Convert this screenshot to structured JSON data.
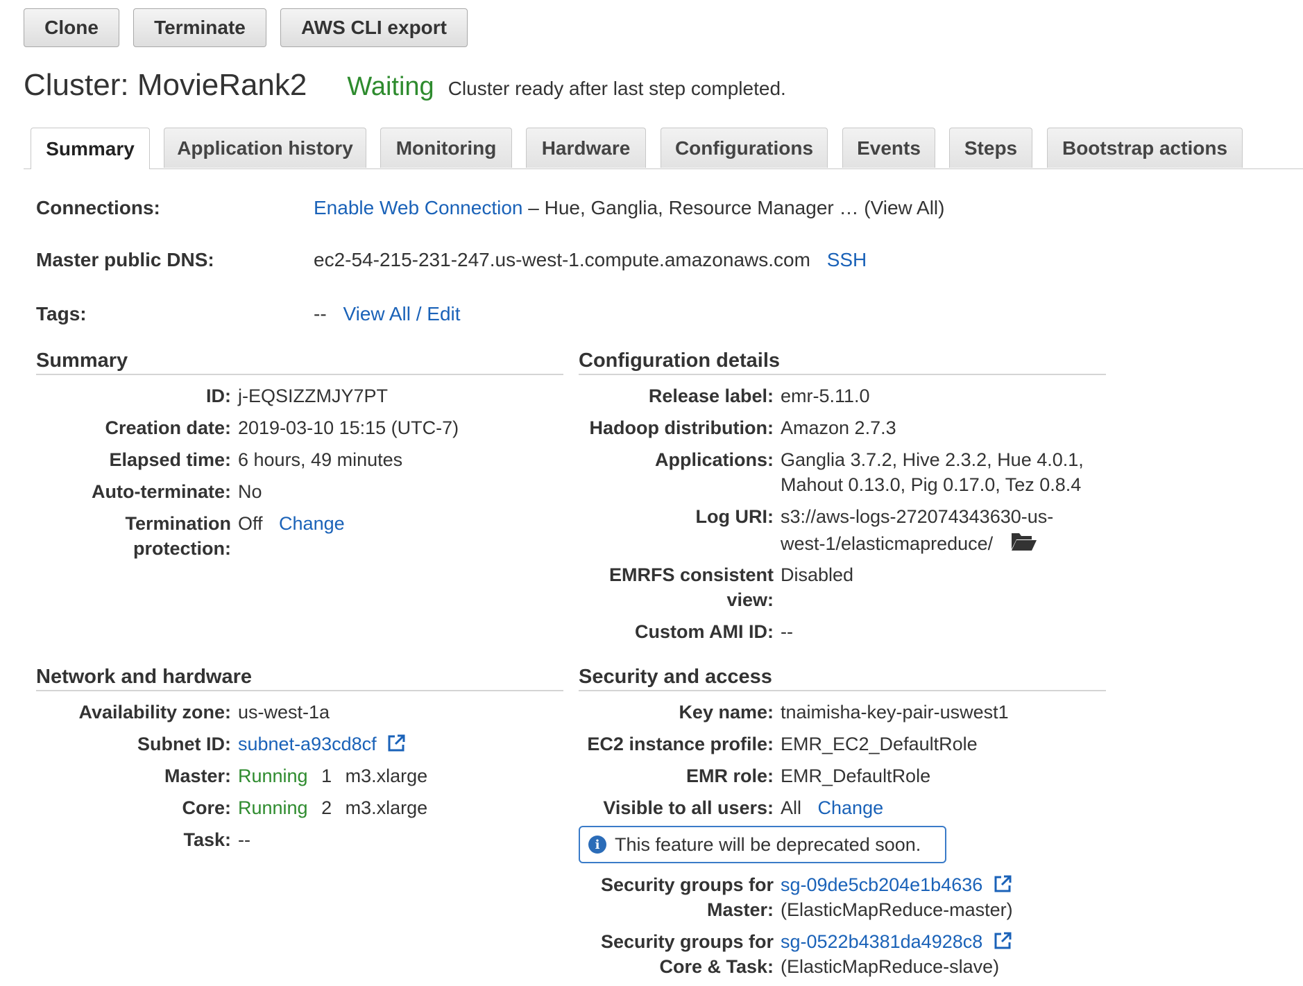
{
  "toolbar": {
    "clone": "Clone",
    "terminate": "Terminate",
    "cli_export": "AWS CLI export"
  },
  "header": {
    "title": "Cluster: MovieRank2",
    "status": "Waiting",
    "status_message": "Cluster ready after last step completed."
  },
  "tabs": [
    "Summary",
    "Application history",
    "Monitoring",
    "Hardware",
    "Configurations",
    "Events",
    "Steps",
    "Bootstrap actions"
  ],
  "active_tab": "Summary",
  "connections": {
    "label": "Connections:",
    "link": "Enable Web Connection",
    "rest": " – Hue, Ganglia, Resource Manager … (View All)"
  },
  "master_dns": {
    "label": "Master public DNS:",
    "value": "ec2-54-215-231-247.us-west-1.compute.amazonaws.com",
    "ssh": "SSH"
  },
  "tags": {
    "label": "Tags:",
    "value": "--",
    "link": "View All / Edit"
  },
  "summary": {
    "heading": "Summary",
    "id_label": "ID:",
    "id": "j-EQSIZZMJY7PT",
    "creation_label": "Creation date:",
    "creation": "2019-03-10 15:15 (UTC-7)",
    "elapsed_label": "Elapsed time:",
    "elapsed": "6 hours, 49 minutes",
    "autoterm_label": "Auto-terminate:",
    "autoterm": "No",
    "termprot_label_1": "Termination",
    "termprot_label_2": "protection:",
    "termprot": "Off",
    "termprot_change": "Change"
  },
  "config": {
    "heading": "Configuration details",
    "release_label": "Release label:",
    "release": "emr-5.11.0",
    "hadoop_label": "Hadoop distribution:",
    "hadoop": "Amazon 2.7.3",
    "apps_label": "Applications:",
    "apps_1": "Ganglia 3.7.2, Hive 2.3.2, Hue 4.0.1,",
    "apps_2": "Mahout 0.13.0, Pig 0.17.0, Tez 0.8.4",
    "log_label": "Log URI:",
    "log_1": "s3://aws-logs-272074343630-us-",
    "log_2": "west-1/elasticmapreduce/",
    "emrfs_label_1": "EMRFS consistent",
    "emrfs_label_2": "view:",
    "emrfs": "Disabled",
    "ami_label": "Custom AMI ID:",
    "ami": "--"
  },
  "network": {
    "heading": "Network and hardware",
    "az_label": "Availability zone:",
    "az": "us-west-1a",
    "subnet_label": "Subnet ID:",
    "subnet": "subnet-a93cd8cf",
    "master_label": "Master:",
    "master_status": "Running",
    "master_count": "1",
    "master_type": "m3.xlarge",
    "core_label": "Core:",
    "core_status": "Running",
    "core_count": "2",
    "core_type": "m3.xlarge",
    "task_label": "Task:",
    "task": "--"
  },
  "security": {
    "heading": "Security and access",
    "key_label": "Key name:",
    "key": "tnaimisha-key-pair-uswest1",
    "profile_label": "EC2 instance profile:",
    "profile": "EMR_EC2_DefaultRole",
    "role_label": "EMR role:",
    "role": "EMR_DefaultRole",
    "visible_label": "Visible to all users:",
    "visible": "All",
    "visible_change": "Change",
    "notice": "This feature will be deprecated soon.",
    "sg_master_label_1": "Security groups for",
    "sg_master_label_2": "Master:",
    "sg_master": "sg-09de5cb204e1b4636",
    "sg_master_name": "(ElasticMapReduce-master)",
    "sg_core_label_1": "Security groups for",
    "sg_core_label_2": "Core & Task:",
    "sg_core": "sg-0522b4381da4928c8",
    "sg_core_name": "(ElasticMapReduce-slave)"
  },
  "colors": {
    "link": "#1a62b8",
    "running": "#2e8b2e",
    "info_border": "#3a7bc8"
  }
}
